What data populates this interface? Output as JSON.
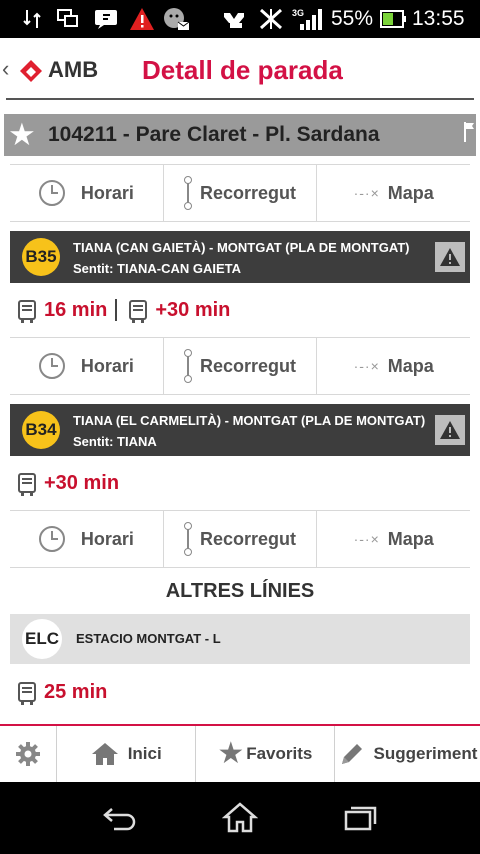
{
  "status_bar": {
    "battery_percent": "55%",
    "time": "13:55",
    "network": "3G"
  },
  "header": {
    "logo_text": "AMB",
    "title": "Detall de parada"
  },
  "stop": {
    "title": "104211 - Pare Claret - Pl. Sardana"
  },
  "actions": {
    "horari": "Horari",
    "recorregut": "Recorregut",
    "mapa": "Mapa"
  },
  "lines": [
    {
      "badge": "B35",
      "route": "TIANA (CAN GAIETÀ) - MONTGAT (PLA DE MONTGAT)",
      "direction": "Sentit: TIANA-CAN GAIETA",
      "times": [
        "16 min",
        "+30 min"
      ]
    },
    {
      "badge": "B34",
      "route": "TIANA (EL CARMELITÀ) - MONTGAT (PLA DE MONTGAT)",
      "direction": "Sentit: TIANA",
      "times": [
        "+30 min"
      ]
    }
  ],
  "other_lines": {
    "title": "ALTRES LÍNIES",
    "items": [
      {
        "badge": "ELC",
        "route": "ESTACIO MONTGAT - L",
        "time": "25 min"
      }
    ]
  },
  "bottom_nav": {
    "inici": "Inici",
    "favorits": "Favorits",
    "suggeriment": "Suggeriment"
  },
  "colors": {
    "accent": "#d31145",
    "badge_yellow": "#f7c21a",
    "line_header": "#3d3d3d"
  }
}
